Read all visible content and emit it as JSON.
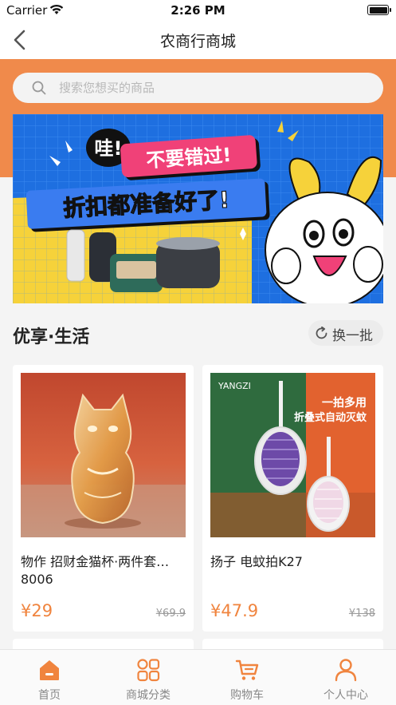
{
  "status_bar": {
    "carrier": "Carrier",
    "time": "2:26 PM"
  },
  "nav": {
    "title": "农商行商城",
    "back_icon": "chevron-left-icon"
  },
  "search": {
    "placeholder": "搜索您想买的商品",
    "icon": "search-icon"
  },
  "banner": {
    "exclaim": "哇!",
    "line1": "不要错过!",
    "line2": "折扣都准备好了!"
  },
  "section": {
    "title": "优享·生活",
    "refresh_label": "换一批"
  },
  "products": [
    {
      "name": "物作 招财金猫杯·两件套…8006",
      "price": "¥29",
      "old_price": "¥69.9"
    },
    {
      "name": "扬子 电蚊拍K27",
      "price": "¥47.9",
      "old_price": "¥138",
      "img_brand": "YANGZI",
      "img_line1": "一拍多用",
      "img_line2": "折叠式自动灭蚊"
    }
  ],
  "tabs": [
    {
      "label": "首页",
      "icon": "home-icon",
      "active": true
    },
    {
      "label": "商城分类",
      "icon": "grid-icon",
      "active": false
    },
    {
      "label": "购物车",
      "icon": "cart-icon",
      "active": false
    },
    {
      "label": "个人中心",
      "icon": "user-icon",
      "active": false
    }
  ],
  "colors": {
    "accent": "#f0843e",
    "header_bg": "#f08a4b",
    "tab_inactive": "#888888"
  }
}
